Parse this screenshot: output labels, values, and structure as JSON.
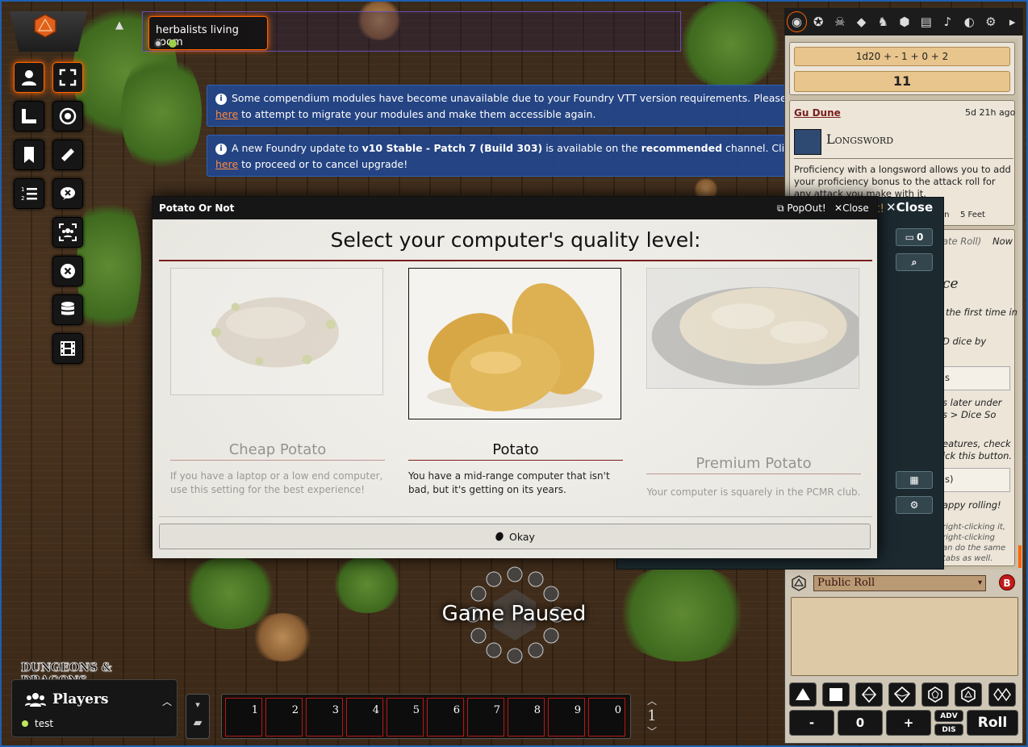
{
  "scene_nav": {
    "active_scene": "herbalists living room",
    "toggle_glyph": "▲"
  },
  "notifications": [
    {
      "segments": [
        {
          "t": "Some compendium modules have become unavailable due to your Foundry VTT version requirements. Please click ",
          "s": "n"
        },
        {
          "t": "here",
          "s": "a"
        },
        {
          "t": " to attempt to migrate your modules and make them accessible again.",
          "s": "n"
        }
      ]
    },
    {
      "segments": [
        {
          "t": "A new Foundry update to ",
          "s": "n"
        },
        {
          "t": "v10 Stable - Patch 7 (Build 303)",
          "s": "b"
        },
        {
          "t": " is available on the ",
          "s": "n"
        },
        {
          "t": "recommended",
          "s": "b"
        },
        {
          "t": " channel. Click ",
          "s": "n"
        },
        {
          "t": "here",
          "s": "a"
        },
        {
          "t": " to proceed or to cancel upgrade!",
          "s": "n"
        }
      ]
    }
  ],
  "dialog": {
    "title": "Potato Or Not",
    "popout_label": "PopOut!",
    "close_label": "Close",
    "heading": "Select your computer's quality level:",
    "options": [
      {
        "label": "Cheap Potato",
        "desc": "If you have a laptop or a low end computer, use this setting for the best experience!",
        "selected": false
      },
      {
        "label": "Potato",
        "desc": "You have a mid-range computer that isn't bad, but it's getting on its years.",
        "selected": true
      },
      {
        "label": "Premium Potato",
        "desc": "Your computer is squarely in the PCMR club.",
        "selected": false
      }
    ],
    "okay_label": "Okay"
  },
  "chat": {
    "formula": "1d20 + - 1 + 0 + 2",
    "total": "11",
    "card_speaker": "Gu Dune",
    "card_time": "5d 21h ago",
    "item_name": "Longsword",
    "item_desc": "Proficiency with a longsword allows you to add your proficiency bonus to the attack roll for any attack you make with it.",
    "item_tag": "5 Feet",
    "item_tag_partial": "on",
    "second_msg_flavor": "ate Roll)",
    "second_msg_time": "Now",
    "second_msg_title_frag": "ce",
    "second_msg_lines": [
      "the first time in",
      "D dice by",
      "s",
      "s later under",
      "s > Dice So",
      "eatures, check",
      "ick this button.",
      "s)",
      "appy rolling!"
    ],
    "second_msg_footer": [
      "right-clicking it,",
      "right-clicking",
      "an do the same",
      "tabs as well."
    ],
    "roll_mode": "Public Roll",
    "dice_count": "0",
    "roll_button": "Roll",
    "minus": "-",
    "plus": "+",
    "adv": "ADV",
    "dis": "DIS"
  },
  "dsn_panel": {
    "close_label": "Close",
    "partial_label": "ut!",
    "message_count": "0"
  },
  "game_paused": "Game Paused",
  "players": {
    "logo_text": "DUNGEONS & DRAGONS",
    "title": "Players",
    "list": [
      "test"
    ]
  },
  "hotbar": {
    "slots": [
      "1",
      "2",
      "3",
      "4",
      "5",
      "6",
      "7",
      "8",
      "9",
      "0"
    ],
    "page": "1"
  },
  "colors": {
    "accent": "#ff6400",
    "notice_bg": "#23468c",
    "hotbar_border": "#b51818"
  }
}
